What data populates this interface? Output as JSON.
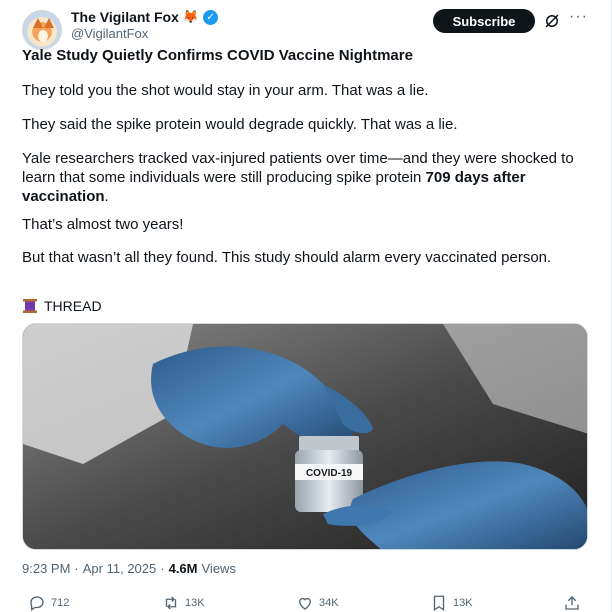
{
  "author": {
    "display_name": "The Vigilant Fox",
    "name_emoji": "🦊",
    "handle": "@VigilantFox",
    "verified_mark": "✓"
  },
  "header": {
    "subscribe_label": "Subscribe",
    "more_label": "···"
  },
  "post": {
    "title": "Yale Study Quietly Confirms COVID Vaccine Nightmare",
    "p1": "They told you the shot would stay in your arm. That was a lie.",
    "p2": "They said the spike protein would degrade quickly. That was a lie.",
    "p3_a": "Yale researchers tracked vax-injured patients over time—and they were shocked to learn that some individuals were still producing spike protein ",
    "p3_bold": "709 days after vaccination",
    "p3_b": ".",
    "p4": "That’s almost two years!",
    "p5": "But that wasn’t all they found. This study should alarm every vaccinated person.",
    "thread_label": "THREAD"
  },
  "media": {
    "vial_label": "COVID-19"
  },
  "meta": {
    "time": "9:23 PM",
    "sep1": "·",
    "date": "Apr 11, 2025",
    "sep2": "·",
    "views_count": "4.6M",
    "views_label": "Views"
  },
  "actions": {
    "replies": "712",
    "reposts": "13K",
    "likes": "34K",
    "bookmarks": "13K"
  },
  "colors": {
    "accent": "#1d9bf0",
    "text": "#0f1419",
    "muted": "#536471",
    "button": "#0f1419"
  }
}
